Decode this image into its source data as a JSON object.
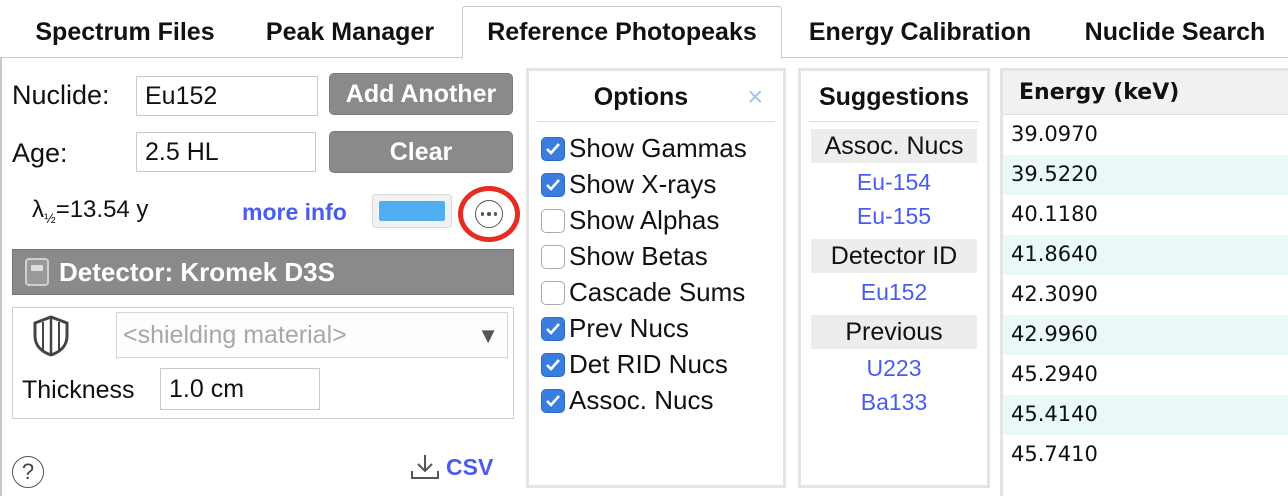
{
  "tabs": [
    {
      "label": "Spectrum Files"
    },
    {
      "label": "Peak Manager"
    },
    {
      "label": "Reference Photopeaks",
      "active": true
    },
    {
      "label": "Energy Calibration"
    },
    {
      "label": "Nuclide Search"
    }
  ],
  "nuclide": {
    "label": "Nuclide:",
    "value": "Eu152",
    "add_button": "Add Another",
    "age_label": "Age:",
    "age_value": "2.5 HL",
    "clear_button": "Clear",
    "halflife_symbol": "λ",
    "halflife_sub": "½",
    "halflife_value": "=13.54 y",
    "more_info": "more info",
    "line_color": "#52aef3"
  },
  "detector": {
    "label": "Detector: Kromek D3S"
  },
  "shielding": {
    "material_placeholder": "<shielding material>",
    "thickness_label": "Thickness",
    "thickness_value": "1.0 cm"
  },
  "csv_label": "CSV",
  "help_label": "?",
  "options": {
    "title": "Options",
    "close": "×",
    "items": [
      {
        "label": "Show Gammas",
        "checked": true
      },
      {
        "label": "Show X-rays",
        "checked": true
      },
      {
        "label": "Show Alphas",
        "checked": false
      },
      {
        "label": "Show Betas",
        "checked": false
      },
      {
        "label": "Cascade Sums",
        "checked": false
      },
      {
        "label": "Prev Nucs",
        "checked": true
      },
      {
        "label": "Det RID Nucs",
        "checked": true
      },
      {
        "label": "Assoc. Nucs",
        "checked": true
      }
    ]
  },
  "suggestions": {
    "title": "Suggestions",
    "assoc_header": "Assoc. Nucs",
    "assoc": [
      "Eu-154",
      "Eu-155"
    ],
    "detector_header": "Detector ID",
    "detector": [
      "Eu152"
    ],
    "previous_header": "Previous",
    "previous": [
      "U223",
      "Ba133"
    ]
  },
  "energy_table": {
    "header": "Energy (keV)",
    "rows": [
      "39.0970",
      "39.5220",
      "40.1180",
      "41.8640",
      "42.3090",
      "42.9960",
      "45.2940",
      "45.4140",
      "45.7410"
    ]
  },
  "colors": {
    "accent_link": "#4a5cf0",
    "checkbox": "#3a7de0",
    "highlight_circle": "#e62d24",
    "button_gray": "#8a8a8a",
    "row_alt": "#eaf8f8"
  }
}
